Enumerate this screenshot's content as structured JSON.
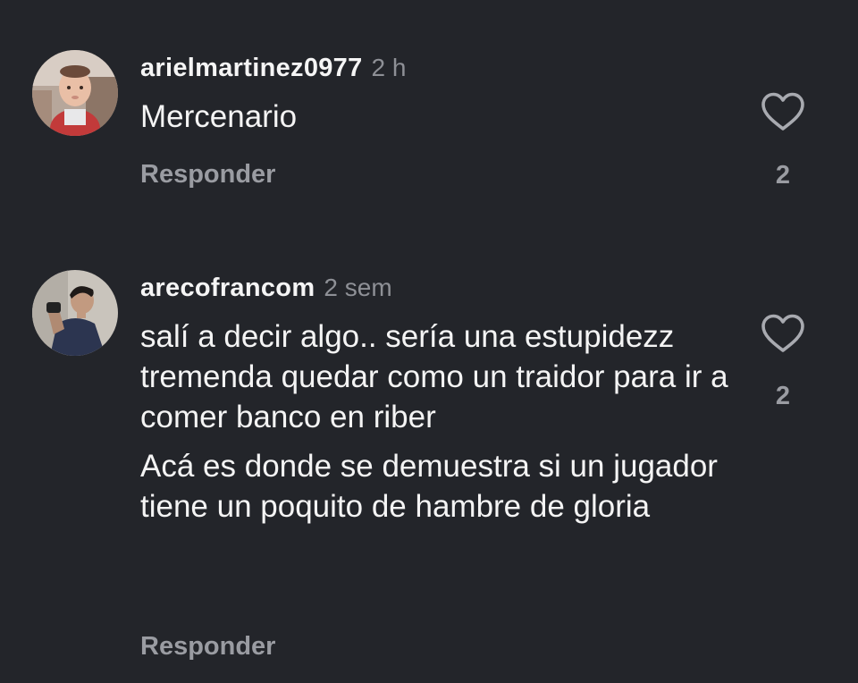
{
  "comments": [
    {
      "username": "arielmartinez0977",
      "time": "2 h",
      "paragraphs": [
        "Mercenario"
      ],
      "reply_label": "Responder",
      "like_icon": "heart-outline-icon",
      "likes": "2"
    },
    {
      "username": "arecofrancom",
      "time": "2 sem",
      "paragraphs": [
        "salí a decir algo.. sería una estupidezz tremenda quedar como un traidor para ir a comer banco en riber",
        "Acá es donde se demuestra si un jugador tiene un poquito de hambre de gloria"
      ],
      "reply_label": "Responder",
      "like_icon": "heart-outline-icon",
      "likes": "2"
    }
  ],
  "colors": {
    "background": "#23252a",
    "text": "#f4f4f4",
    "muted": "#9a9ca2",
    "time": "#8e9096"
  }
}
